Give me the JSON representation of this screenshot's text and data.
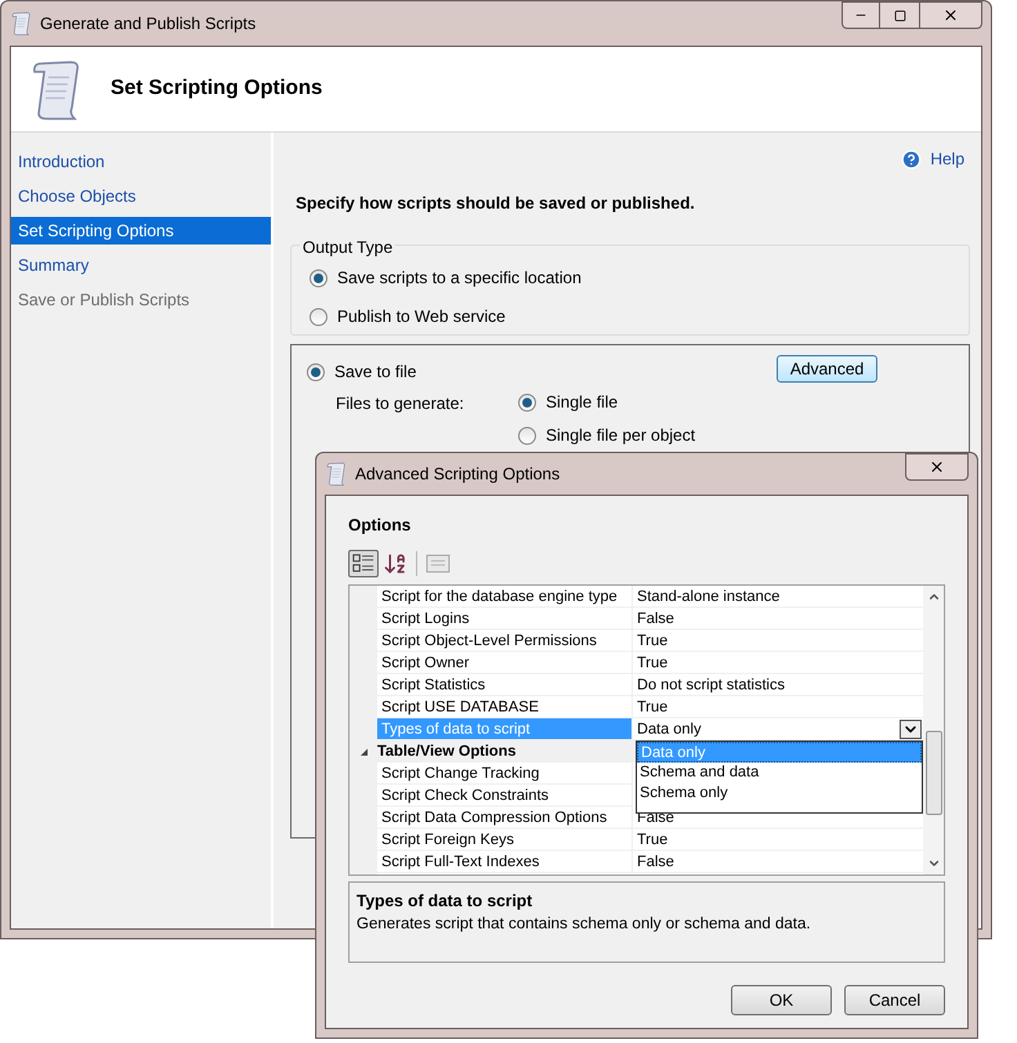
{
  "window": {
    "title": "Generate and Publish Scripts",
    "header_title": "Set Scripting Options"
  },
  "sidebar": {
    "items": [
      {
        "label": "Introduction",
        "selected": false,
        "disabled": false
      },
      {
        "label": "Choose Objects",
        "selected": false,
        "disabled": false
      },
      {
        "label": "Set Scripting Options",
        "selected": true,
        "disabled": false
      },
      {
        "label": "Summary",
        "selected": false,
        "disabled": false
      },
      {
        "label": "Save or Publish Scripts",
        "selected": false,
        "disabled": true
      }
    ]
  },
  "help": {
    "label": "Help"
  },
  "instruction": "Specify how scripts should be saved or published.",
  "output_type": {
    "legend": "Output Type",
    "options": [
      {
        "label": "Save scripts to a specific location",
        "selected": true
      },
      {
        "label": "Publish to Web service",
        "selected": false
      }
    ]
  },
  "save_to_file": {
    "label": "Save to file",
    "selected": true
  },
  "advanced_button": "Advanced",
  "files_to_generate": {
    "label": "Files to generate:",
    "options": [
      {
        "label": "Single file",
        "selected": true
      },
      {
        "label": "Single file per object",
        "selected": false
      }
    ]
  },
  "dialog": {
    "title": "Advanced Scripting Options",
    "options_label": "Options",
    "grid": {
      "rows": [
        {
          "kind": "property",
          "name": "Script for the database engine type",
          "value": "Stand-alone instance",
          "selected": false
        },
        {
          "kind": "property",
          "name": "Script Logins",
          "value": "False",
          "selected": false
        },
        {
          "kind": "property",
          "name": "Script Object-Level Permissions",
          "value": "True",
          "selected": false
        },
        {
          "kind": "property",
          "name": "Script Owner",
          "value": "True",
          "selected": false
        },
        {
          "kind": "property",
          "name": "Script Statistics",
          "value": "Do not script statistics",
          "selected": false
        },
        {
          "kind": "property",
          "name": "Script USE DATABASE",
          "value": "True",
          "selected": false
        },
        {
          "kind": "property",
          "name": "Types of data to script",
          "value": "Data only",
          "selected": true
        },
        {
          "kind": "category",
          "name": "Table/View Options",
          "expanded": true
        },
        {
          "kind": "property",
          "name": "Script Change Tracking",
          "selected": false
        },
        {
          "kind": "property",
          "name": "Script Check Constraints",
          "selected": false
        },
        {
          "kind": "property",
          "name": "Script Data Compression Options",
          "value": "False",
          "selected": false
        },
        {
          "kind": "property",
          "name": "Script Foreign Keys",
          "value": "True",
          "selected": false
        },
        {
          "kind": "property",
          "name": "Script Full-Text Indexes",
          "value": "False",
          "selected": false
        }
      ]
    },
    "dropdown": {
      "items": [
        {
          "label": "Data only",
          "selected": true
        },
        {
          "label": "Schema and data",
          "selected": false
        },
        {
          "label": "Schema only",
          "selected": false
        }
      ]
    },
    "description": {
      "title": "Types of data to script",
      "text": "Generates script that contains schema only or schema and data."
    },
    "buttons": [
      "OK",
      "Cancel"
    ]
  }
}
